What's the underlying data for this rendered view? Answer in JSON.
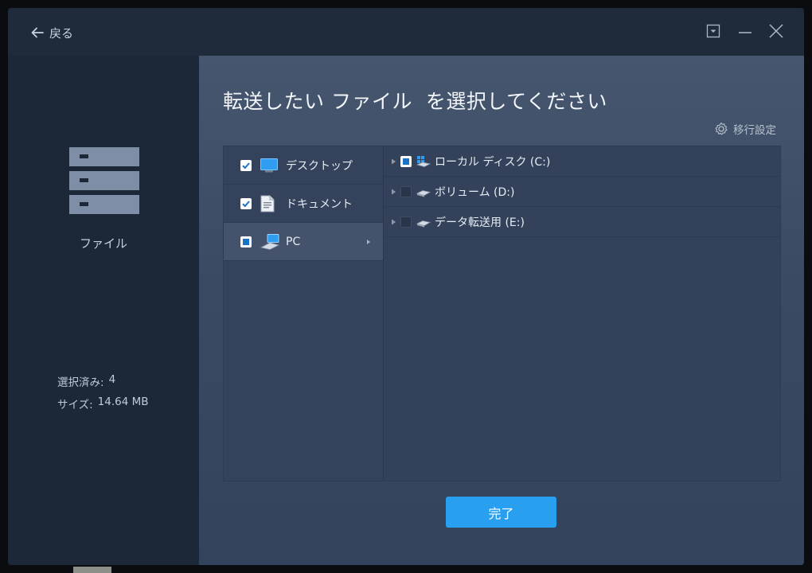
{
  "header": {
    "back_label": "戻る"
  },
  "sidebar": {
    "category_label": "ファイル",
    "selected_label": "選択済み:",
    "selected_count": "4",
    "size_label": "サイズ:",
    "size_value": "14.64 MB"
  },
  "main": {
    "title": "転送したい ファイル  を選択してください",
    "settings_label": "移行設定",
    "done_button": "完了"
  },
  "left_items": [
    {
      "label": "デスクトップ",
      "state": "checked",
      "icon": "desktop-icon"
    },
    {
      "label": "ドキュメント",
      "state": "checked",
      "icon": "document-icon"
    },
    {
      "label": "PC",
      "state": "partial",
      "icon": "pc-icon"
    }
  ],
  "drives": [
    {
      "label": "ローカル ディスク (C:)",
      "state": "partial",
      "icon": "system-drive-icon"
    },
    {
      "label": "ボリューム (D:)",
      "state": "empty",
      "icon": "drive-icon"
    },
    {
      "label": "データ転送用 (E:)",
      "state": "empty",
      "icon": "drive-icon"
    }
  ],
  "colors": {
    "accent": "#28a0ef",
    "check_blue": "#1a72c9",
    "window_bg": "#1c2637",
    "main_bg": "#3f4f67"
  }
}
